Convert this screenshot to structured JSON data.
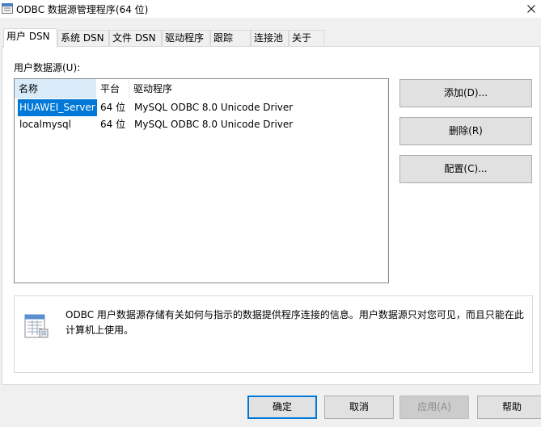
{
  "window": {
    "title": "ODBC 数据源管理程序(64 位)",
    "close_glyph": "✕"
  },
  "tabs": [
    {
      "label": "用户 DSN",
      "active": true
    },
    {
      "label": "系统 DSN",
      "active": false
    },
    {
      "label": "文件 DSN",
      "active": false
    },
    {
      "label": "驱动程序",
      "active": false
    },
    {
      "label": "跟踪",
      "active": false
    },
    {
      "label": "连接池",
      "active": false
    },
    {
      "label": "关于",
      "active": false
    }
  ],
  "user_dsn": {
    "list_label": "用户数据源(U):",
    "columns": [
      "名称",
      "平台",
      "驱动程序"
    ],
    "rows": [
      {
        "name": "HUAWEI_Server",
        "platform": "64 位",
        "driver": "MySQL ODBC 8.0 Unicode Driver",
        "selected": true
      },
      {
        "name": "localmysql",
        "platform": "64 位",
        "driver": "MySQL ODBC 8.0 Unicode Driver",
        "selected": false
      }
    ],
    "buttons": {
      "add": "添加(D)...",
      "remove": "删除(R)",
      "configure": "配置(C)..."
    },
    "info": {
      "icon": "database-table-icon",
      "text": "ODBC 用户数据源存储有关如何与指示的数据提供程序连接的信息。用户数据源只对您可见，而且只能在此计算机上使用。"
    }
  },
  "footer": {
    "ok": "确定",
    "cancel": "取消",
    "apply": "应用(A)",
    "help": "帮助"
  },
  "colors": {
    "accent": "#0078d7",
    "selection": "#0078d7",
    "header_highlight": "#d9ebf9"
  }
}
